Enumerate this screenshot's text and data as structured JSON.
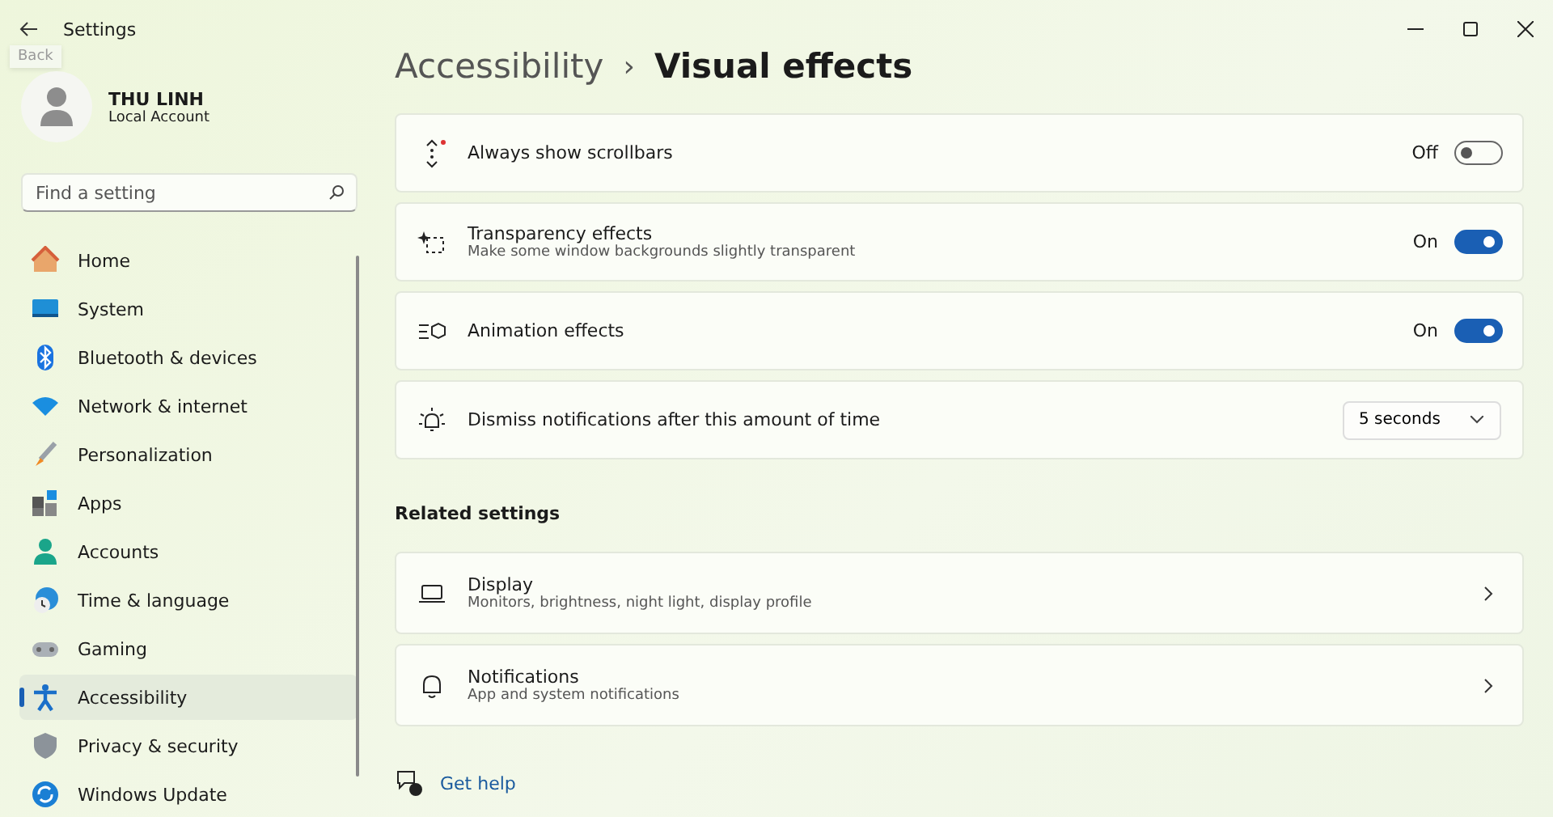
{
  "window": {
    "title": "Settings",
    "back_tooltip": "Back"
  },
  "profile": {
    "name": "THU LINH",
    "account": "Local Account"
  },
  "search": {
    "placeholder": "Find a setting"
  },
  "sidebar": {
    "items": [
      {
        "label": "Home",
        "selected": false
      },
      {
        "label": "System",
        "selected": false
      },
      {
        "label": "Bluetooth & devices",
        "selected": false
      },
      {
        "label": "Network & internet",
        "selected": false
      },
      {
        "label": "Personalization",
        "selected": false
      },
      {
        "label": "Apps",
        "selected": false
      },
      {
        "label": "Accounts",
        "selected": false
      },
      {
        "label": "Time & language",
        "selected": false
      },
      {
        "label": "Gaming",
        "selected": false
      },
      {
        "label": "Accessibility",
        "selected": true
      },
      {
        "label": "Privacy & security",
        "selected": false
      },
      {
        "label": "Windows Update",
        "selected": false
      }
    ]
  },
  "breadcrumb": {
    "parent": "Accessibility",
    "separator": "›",
    "current": "Visual effects"
  },
  "settings": [
    {
      "kind": "toggle",
      "title": "Always show scrollbars",
      "state_text": "Off",
      "on": false
    },
    {
      "kind": "toggle",
      "title": "Transparency effects",
      "description": "Make some window backgrounds slightly transparent",
      "state_text": "On",
      "on": true
    },
    {
      "kind": "toggle",
      "title": "Animation effects",
      "state_text": "On",
      "on": true
    },
    {
      "kind": "dropdown",
      "title": "Dismiss notifications after this amount of time",
      "value": "5 seconds"
    }
  ],
  "related": {
    "heading": "Related settings",
    "items": [
      {
        "title": "Display",
        "description": "Monitors, brightness, night light, display profile"
      },
      {
        "title": "Notifications",
        "description": "App and system notifications"
      }
    ]
  },
  "help": {
    "label": "Get help"
  }
}
